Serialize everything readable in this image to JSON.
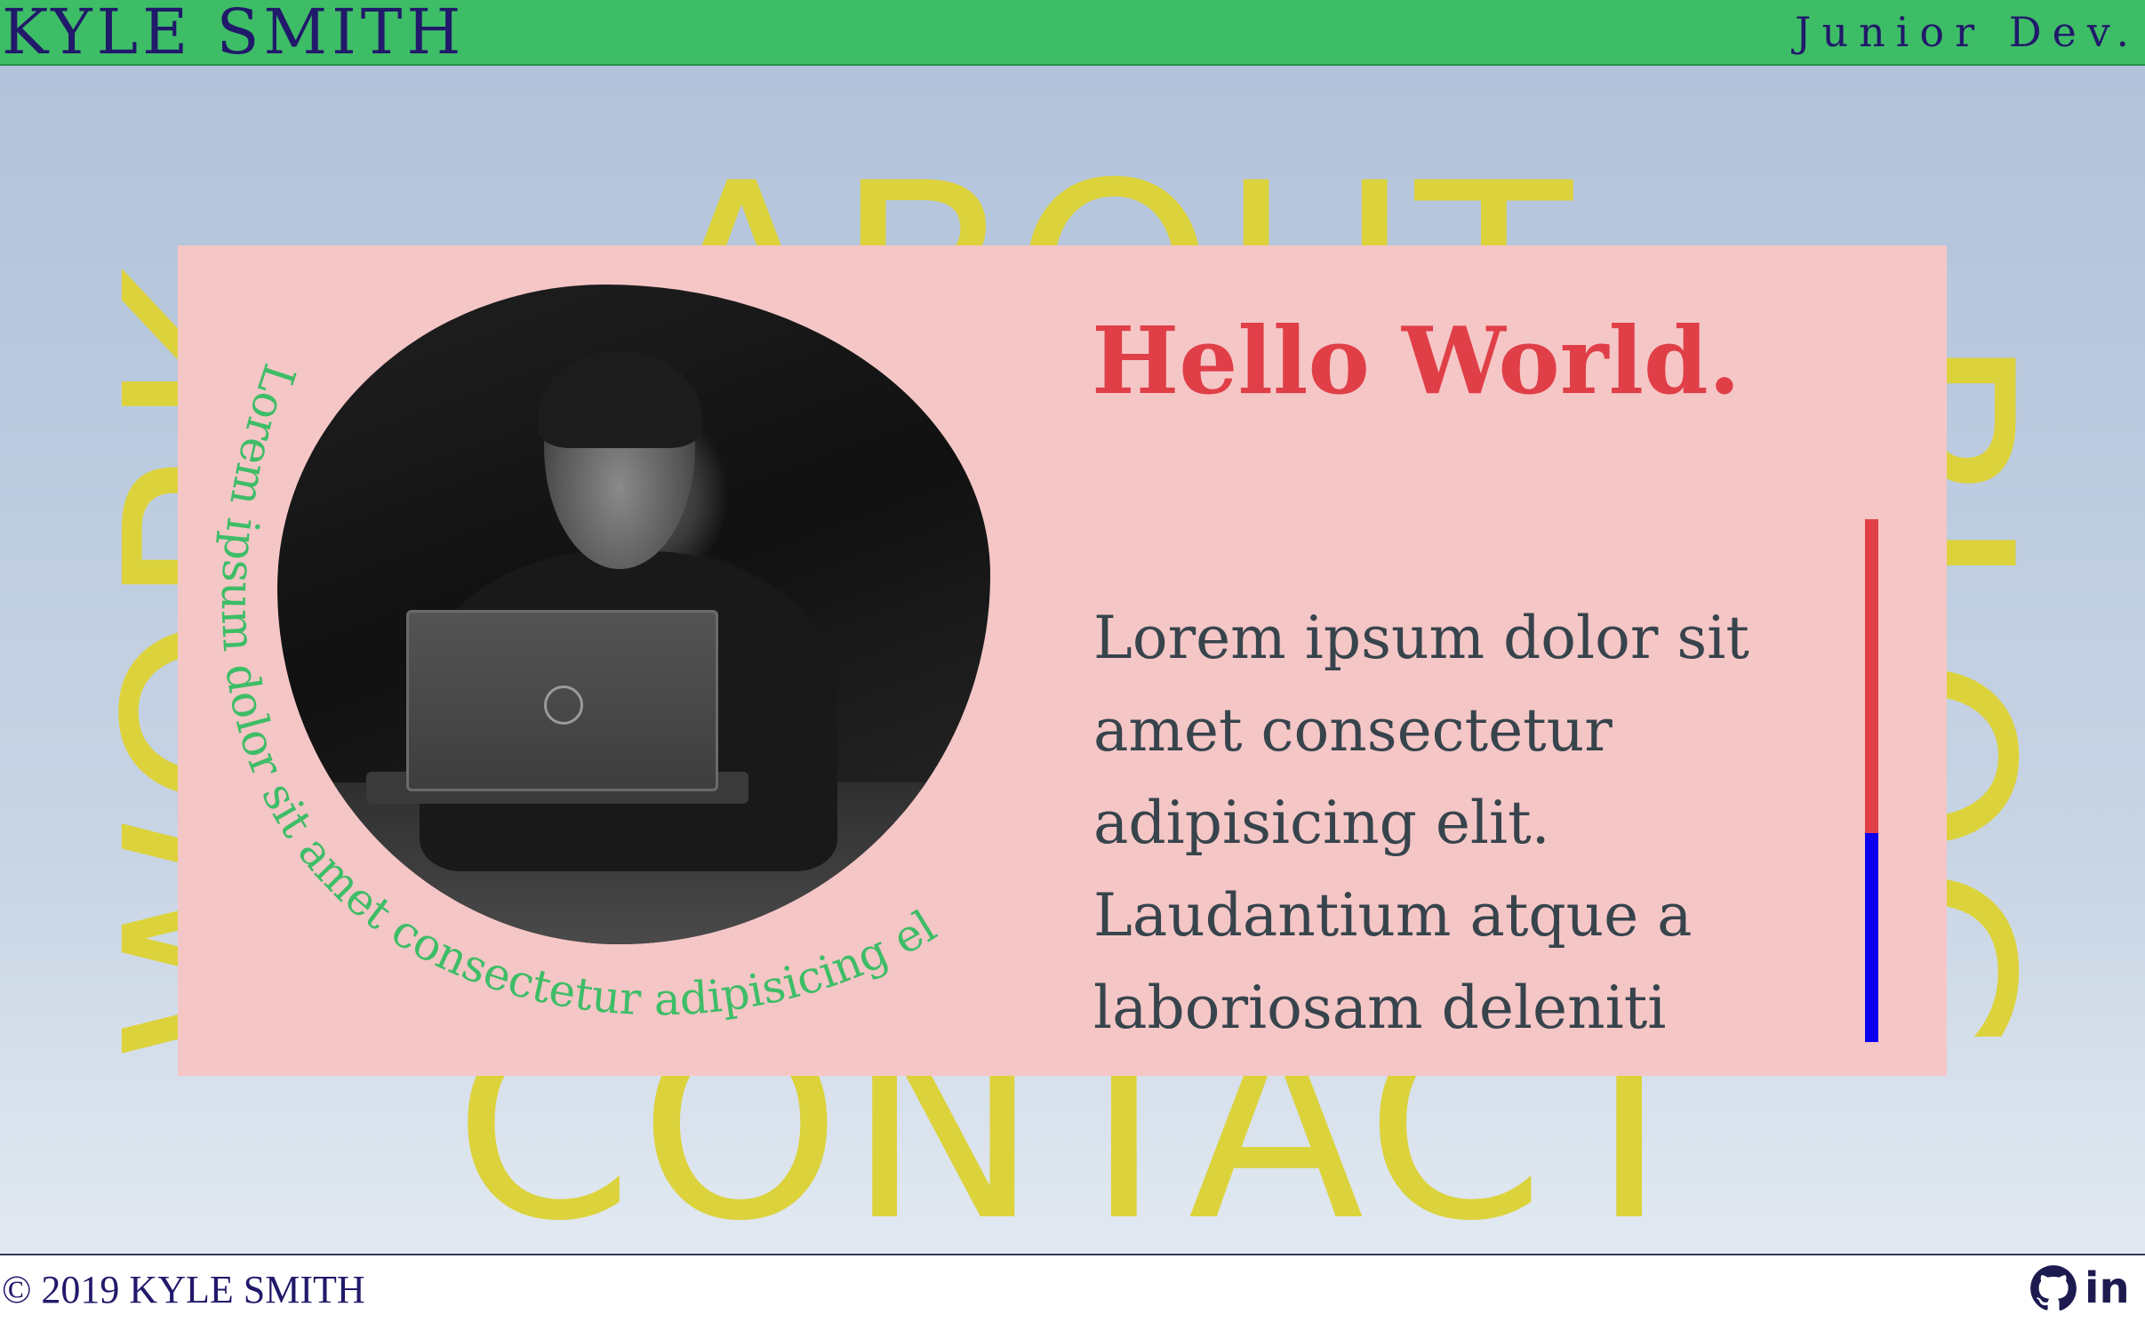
{
  "header": {
    "brand": "KYLE SMITH",
    "role": "Junior Dev."
  },
  "nav": {
    "about": "ABOUT",
    "work": "WORK",
    "blog": "BLOG",
    "contact": "CONTACT"
  },
  "hero": {
    "curved_caption": "Lorem ipsum dolor sit amet consectetur adipisicing el",
    "heading": "Hello World.",
    "bio": "Lorem ipsum dolor sit amet consectetur adipisicing elit. Laudantium atque a laboriosam deleniti"
  },
  "footer": {
    "copyright": "© 2019 KYLE SMITH",
    "social": [
      {
        "name": "github-icon"
      },
      {
        "name": "linkedin-icon",
        "glyph": "in"
      }
    ]
  },
  "colors": {
    "header_bg": "#3ebd67",
    "brand_text": "#21196a",
    "nav_word": "#dcd23c",
    "card_bg": "#f5c6c6",
    "heading": "#e03f48",
    "body_text": "#37444c",
    "caption": "#3ebd67",
    "accent_red": "#e03f48",
    "accent_blue": "#0a00ef"
  }
}
